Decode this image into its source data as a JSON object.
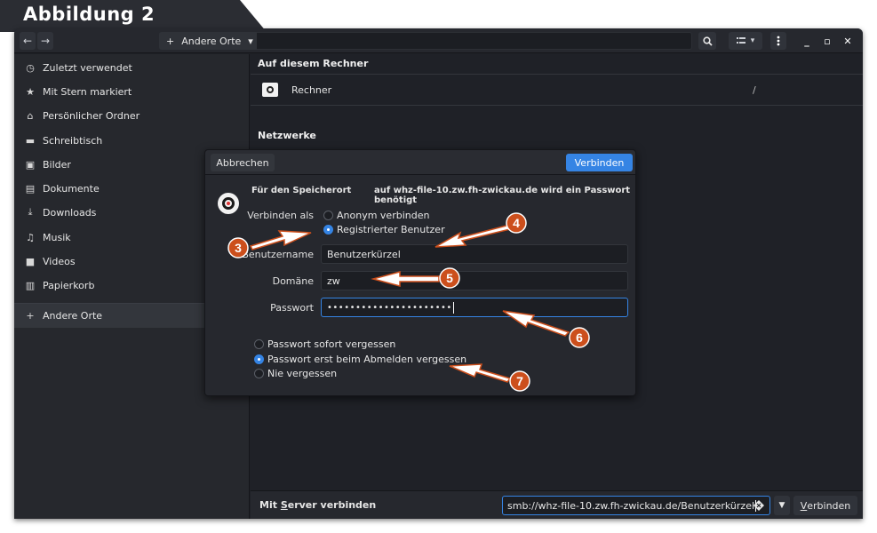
{
  "figure": {
    "title": "Abbildung 2"
  },
  "headerbar": {
    "path_plus": "+",
    "path_label": "Andere Orte",
    "path_dropdown": "▾",
    "search_icon": "search-icon",
    "minimize": "_",
    "maximize": "▫",
    "close": "✕"
  },
  "sidebar": {
    "items": [
      {
        "label": "Zuletzt verwendet",
        "icon": "◷"
      },
      {
        "label": "Mit Stern markiert",
        "icon": "★"
      },
      {
        "label": "Persönlicher Ordner",
        "icon": "⌂"
      },
      {
        "label": "Schreibtisch",
        "icon": "▬"
      },
      {
        "label": "Bilder",
        "icon": "▣"
      },
      {
        "label": "Dokumente",
        "icon": "▤"
      },
      {
        "label": "Downloads",
        "icon": "⤓"
      },
      {
        "label": "Musik",
        "icon": "♫"
      },
      {
        "label": "Videos",
        "icon": "■"
      },
      {
        "label": "Papierkorb",
        "icon": "▥"
      }
    ],
    "other_places": {
      "label": "Andere Orte",
      "icon": "+"
    }
  },
  "main": {
    "on_this_computer": "Auf diesem Rechner",
    "computer_label": "Rechner",
    "computer_path": "/",
    "networks": "Netzwerke"
  },
  "bottom": {
    "connect_label_pre": "Mit ",
    "connect_label_u": "S",
    "connect_label_post": "erver verbinden",
    "server_value": "smb://whz-file-10.zw.fh-zwickau.de/Benutzerkürzel",
    "connect_button_u": "V",
    "connect_button_rest": "erbinden"
  },
  "dialog": {
    "cancel": "Abbrechen",
    "connect": "Verbinden",
    "info_left": "Für den Speicherort",
    "info_right": "auf whz-file-10.zw.fh-zwickau.de wird ein Passwort benötigt",
    "connect_as_label": "Verbinden als",
    "anon": "Anonym verbinden",
    "registered": "Registrierter Benutzer",
    "username_label": "Benutzername",
    "username_value": "Benutzerkürzel",
    "domain_label": "Domäne",
    "domain_value": "zw",
    "password_label": "Passwort",
    "password_value": "••••••••••••••••••••••",
    "forget_now": "Passwort sofort vergessen",
    "forget_logout": "Passwort erst beim Abmelden vergessen",
    "never_forget": "Nie vergessen"
  },
  "annotations": [
    {
      "num": "3"
    },
    {
      "num": "4"
    },
    {
      "num": "5"
    },
    {
      "num": "6"
    },
    {
      "num": "7"
    }
  ],
  "colors": {
    "accent": "#3584e4",
    "callout": "#cc4f1c",
    "window_bg": "#1f2127"
  }
}
